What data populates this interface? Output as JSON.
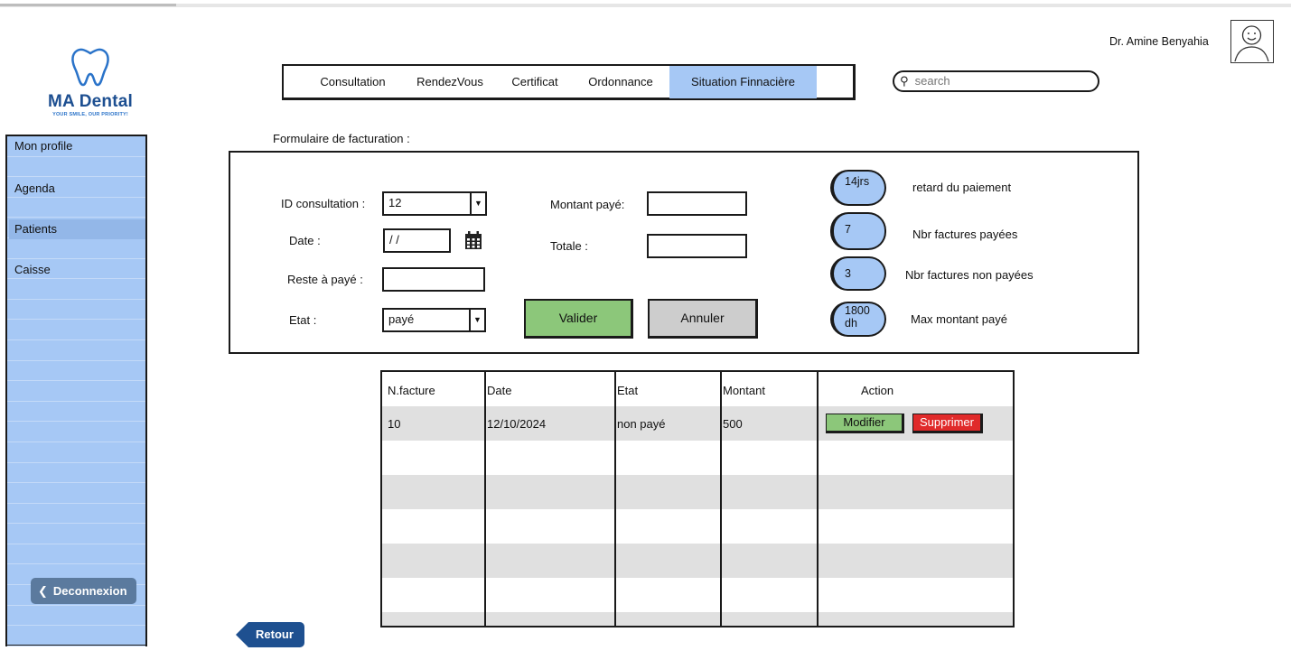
{
  "app": {
    "logo_name": "MA Dental",
    "logo_tagline": "YOUR SMILE, OUR PRIORITY!"
  },
  "user": {
    "name": "Dr. Amine Benyahia"
  },
  "sidebar": {
    "items": [
      {
        "label": "Mon profile"
      },
      {
        "label": "Agenda"
      },
      {
        "label": "Patients"
      },
      {
        "label": "Caisse"
      }
    ],
    "active_index": 2,
    "logout_label": "Deconnexion"
  },
  "nav": {
    "tabs": [
      {
        "label": "Consultation"
      },
      {
        "label": "RendezVous"
      },
      {
        "label": "Certificat"
      },
      {
        "label": "Ordonnance"
      },
      {
        "label": "Situation Finnacière"
      }
    ],
    "active_index": 4
  },
  "search": {
    "placeholder": "search"
  },
  "form": {
    "title": "Formulaire de facturation :",
    "id_consultation_label": "ID consultation :",
    "id_consultation_value": "12",
    "date_label": "Date :",
    "date_value": "/ /",
    "reste_label": "Reste à payé :",
    "reste_value": "",
    "etat_label": "Etat :",
    "etat_value": "payé",
    "montant_label": "Montant payé:",
    "montant_value": "",
    "totale_label": "Totale :",
    "totale_value": "",
    "valider_label": "Valider",
    "annuler_label": "Annuler"
  },
  "stats": [
    {
      "value": "14jrs",
      "label": "retard du paiement"
    },
    {
      "value": "7",
      "label": "Nbr factures payées"
    },
    {
      "value": "3",
      "label": "Nbr factures non payées"
    },
    {
      "value": "1800 dh",
      "label": "Max montant payé"
    }
  ],
  "table": {
    "headers": [
      "N.facture",
      "Date",
      "Etat",
      "Montant",
      "Action"
    ],
    "rows": [
      {
        "n_facture": "10",
        "date": "12/10/2024",
        "etat": "non payé",
        "montant": "500"
      }
    ],
    "modifier_label": "Modifier",
    "supprimer_label": "Supprimer"
  },
  "retour_label": "Retour",
  "colors": {
    "accent_blue": "#a6c8f5",
    "button_green": "#8cc77a",
    "button_red": "#e02a2a",
    "button_grey": "#cdcdcd",
    "dark_blue": "#1e5090"
  }
}
